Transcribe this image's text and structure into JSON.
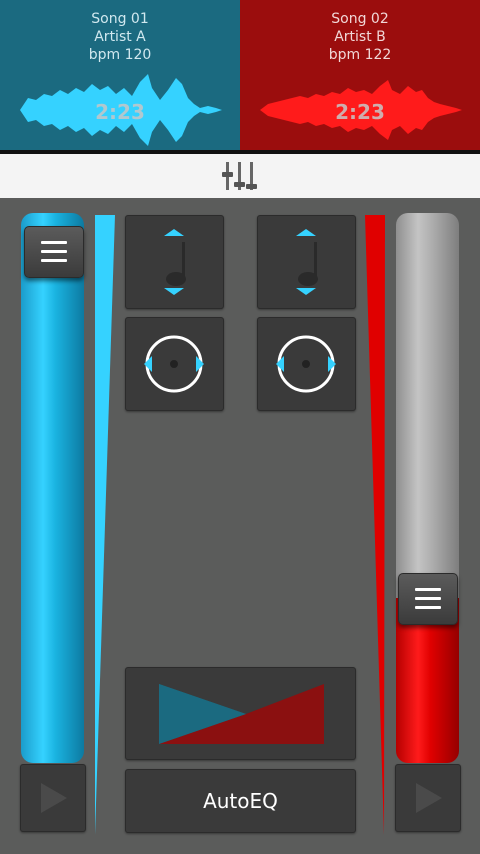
{
  "deck_a": {
    "song": "Song 01",
    "artist": "Artist A",
    "bpm": "bpm 120",
    "time": "2:23",
    "color": "#35d2ff",
    "header_color": "#1b6a80"
  },
  "deck_b": {
    "song": "Song 02",
    "artist": "Artist B",
    "bpm": "bpm 122",
    "time": "2:23",
    "color": "#ff1b1b",
    "header_color": "#9b0d0d"
  },
  "mixer_bar": {
    "icon": "mixer-sliders-icon"
  },
  "controls": {
    "auto_eq_label": "AutoEQ",
    "pitch_icon": "music-note-pitch-icon",
    "jog_icon": "vinyl-jog-icon",
    "crossfader_icon": "crossfader-icon",
    "play_icon": "play-icon",
    "menu_icon": "hamburger-menu-icon"
  },
  "levels": {
    "deck_a_volume": 1.0,
    "deck_b_volume": 0.3
  }
}
